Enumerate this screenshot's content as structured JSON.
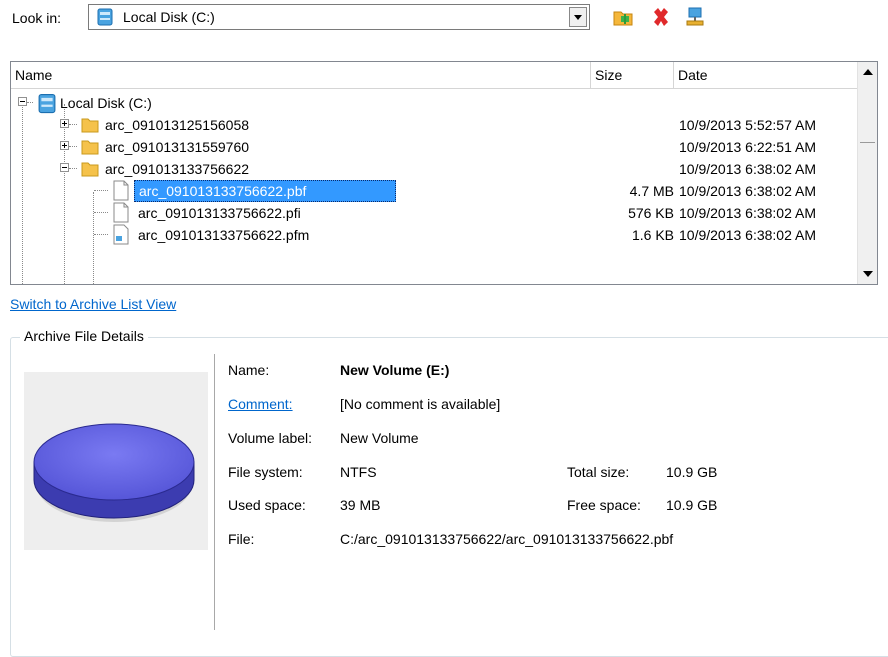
{
  "look_in": {
    "label": "Look in:",
    "value": "Local Disk (C:)"
  },
  "toolbar": {
    "icons": [
      "new-folder-icon",
      "delete-icon",
      "network-drive-icon"
    ]
  },
  "list": {
    "columns": [
      "Name",
      "Size",
      "Date"
    ],
    "root": "Local Disk (C:)",
    "rows": [
      {
        "name": "arc_091013125156058",
        "size": "",
        "date": "10/9/2013 5:52:57 AM"
      },
      {
        "name": "arc_091013131559760",
        "size": "",
        "date": "10/9/2013 6:22:51 AM"
      },
      {
        "name": "arc_091013133756622",
        "size": "",
        "date": "10/9/2013 6:38:02 AM"
      },
      {
        "name": "arc_091013133756622.pbf",
        "size": "4.7 MB",
        "date": "10/9/2013 6:38:02 AM"
      },
      {
        "name": "arc_091013133756622.pfi",
        "size": "576 KB",
        "date": "10/9/2013 6:38:02 AM"
      },
      {
        "name": "arc_091013133756622.pfm",
        "size": "1.6 KB",
        "date": "10/9/2013 6:38:02 AM"
      }
    ]
  },
  "switch_link": "Switch to Archive List View",
  "details": {
    "group_title": "Archive File Details",
    "name_label": "Name:",
    "name_value": "New Volume (E:)",
    "comment_label": "Comment:",
    "comment_value": "[No comment is available]",
    "volume_label_label": "Volume label:",
    "volume_label_value": "New Volume",
    "file_system_label": "File system:",
    "file_system_value": "NTFS",
    "total_size_label": "Total size:",
    "total_size_value": "10.9 GB",
    "used_space_label": "Used space:",
    "used_space_value": "39 MB",
    "free_space_label": "Free space:",
    "free_space_value": "10.9 GB",
    "file_label": "File:",
    "file_value": "C:/arc_091013133756622/arc_091013133756622.pbf"
  },
  "colors": {
    "selection": "#3399ff",
    "link": "#0066cc",
    "disk": "#6b6bea"
  }
}
